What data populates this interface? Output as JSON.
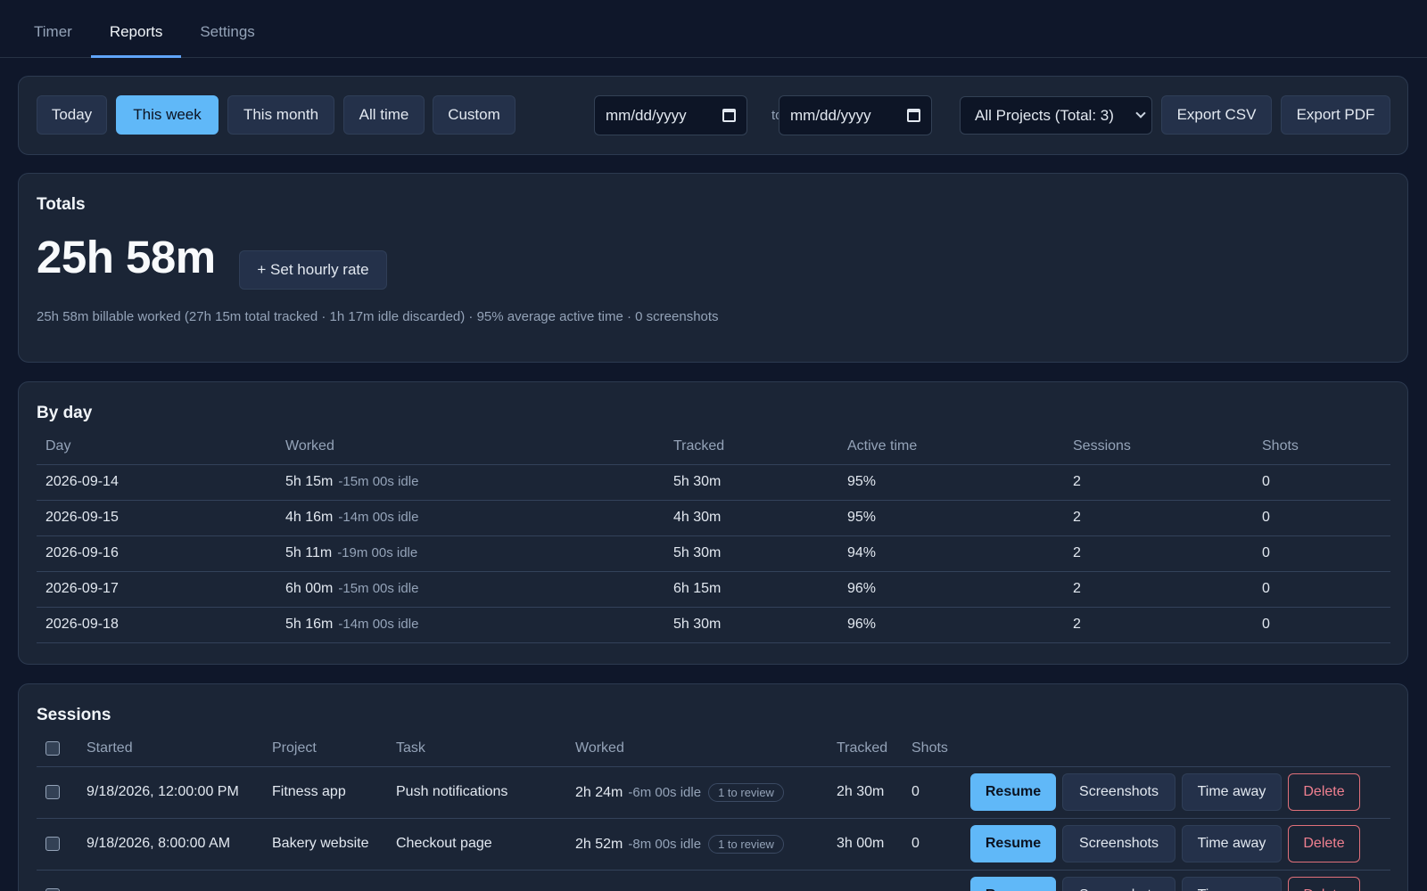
{
  "nav": {
    "tabs": [
      {
        "label": "Timer"
      },
      {
        "label": "Reports"
      },
      {
        "label": "Settings"
      }
    ]
  },
  "filters": {
    "ranges": [
      "Today",
      "This week",
      "This month",
      "All time",
      "Custom"
    ],
    "active_range": "This week",
    "from_placeholder": "mm/dd/yyyy",
    "to_label": "to",
    "to_placeholder": "mm/dd/yyyy",
    "project_select": "All Projects (Total: 3)",
    "export_csv": "Export CSV",
    "export_pdf": "Export PDF"
  },
  "totals": {
    "title": "Totals",
    "total": "25h 58m",
    "set_rate": "+ Set hourly rate",
    "summary": "25h 58m billable worked (27h 15m total tracked · 1h 17m idle discarded) · 95% average active time · 0 screenshots"
  },
  "by_day": {
    "title": "By day",
    "headers": [
      "Day",
      "Worked",
      "Tracked",
      "Active time",
      "Sessions",
      "Shots"
    ],
    "rows": [
      {
        "day": "2026-09-14",
        "worked": "5h 15m",
        "idle": "-15m 00s idle",
        "tracked": "5h 30m",
        "active": "95%",
        "sessions": "2",
        "shots": "0"
      },
      {
        "day": "2026-09-15",
        "worked": "4h 16m",
        "idle": "-14m 00s idle",
        "tracked": "4h 30m",
        "active": "95%",
        "sessions": "2",
        "shots": "0"
      },
      {
        "day": "2026-09-16",
        "worked": "5h 11m",
        "idle": "-19m 00s idle",
        "tracked": "5h 30m",
        "active": "94%",
        "sessions": "2",
        "shots": "0"
      },
      {
        "day": "2026-09-17",
        "worked": "6h 00m",
        "idle": "-15m 00s idle",
        "tracked": "6h 15m",
        "active": "96%",
        "sessions": "2",
        "shots": "0"
      },
      {
        "day": "2026-09-18",
        "worked": "5h 16m",
        "idle": "-14m 00s idle",
        "tracked": "5h 30m",
        "active": "96%",
        "sessions": "2",
        "shots": "0"
      }
    ]
  },
  "sessions": {
    "title": "Sessions",
    "headers": [
      "Started",
      "Project",
      "Task",
      "Worked",
      "Tracked",
      "Shots"
    ],
    "actions": {
      "resume": "Resume",
      "screenshots": "Screenshots",
      "time_away": "Time away",
      "delete": "Delete"
    },
    "rows": [
      {
        "started": "9/18/2026, 12:00:00 PM",
        "project": "Fitness app",
        "task": "Push notifications",
        "worked": "2h 24m",
        "idle": "-6m 00s idle",
        "review": "1 to review",
        "tracked": "2h 30m",
        "shots": "0"
      },
      {
        "started": "9/18/2026, 8:00:00 AM",
        "project": "Bakery website",
        "task": "Checkout page",
        "worked": "2h 52m",
        "idle": "-8m 00s idle",
        "review": "1 to review",
        "tracked": "3h 00m",
        "shots": "0"
      }
    ]
  },
  "colors": {
    "background": "#0f172a",
    "card": "#1b2536",
    "accent": "#60b8f8",
    "danger": "#f08090"
  }
}
